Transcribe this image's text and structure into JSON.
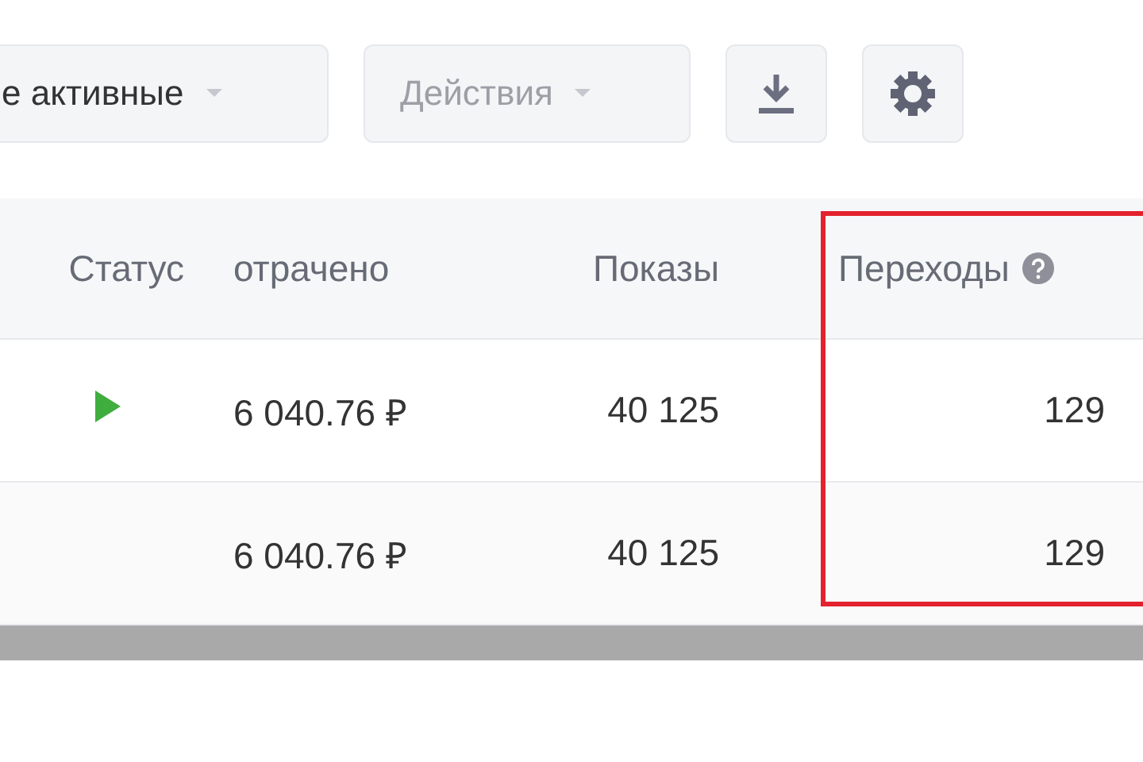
{
  "toolbar": {
    "filter_dropdown": {
      "label": "е активные"
    },
    "actions_dropdown": {
      "label": "Действия",
      "disabled": true
    }
  },
  "table": {
    "columns": [
      {
        "label": "Статус",
        "highlighted": false
      },
      {
        "label": "отрачено",
        "highlighted": false
      },
      {
        "label": "Показы",
        "highlighted": false
      },
      {
        "label": "Переходы",
        "highlighted": true
      }
    ],
    "rows": [
      {
        "running": true,
        "spent": "6 040.76 ₽",
        "impressions": "40 125",
        "clicks": "129"
      },
      {
        "running": false,
        "spent": "6 040.76 ₽",
        "impressions": "40 125",
        "clicks": "129"
      }
    ]
  }
}
